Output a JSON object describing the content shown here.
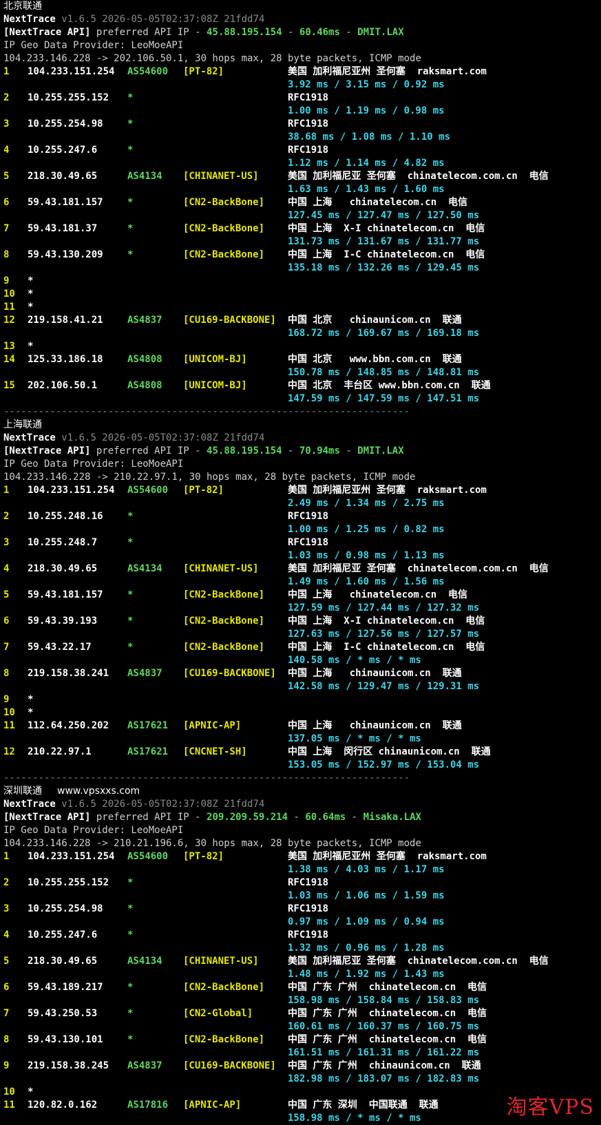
{
  "colors": {
    "background": "#000000",
    "hop": "#e6e600",
    "asn": "#5fd75f",
    "tag": "#e6e600",
    "latency": "#3fd3e6",
    "api": "#5fd75f",
    "version": "#8a8a8a"
  },
  "watermark": "淘客VPS",
  "sections": [
    {
      "title": "北京联通",
      "site": "",
      "brand": "NextTrace",
      "version": "v1.6.5 2026-05-05T02:37:08Z 21fdd74",
      "api_label": "[NextTrace API]",
      "api_text": "preferred API IP -",
      "api_ip": "45.88.195.154",
      "api_latency": "60.46ms",
      "api_node": "DMIT.LAX",
      "geo_provider": "IP Geo Data Provider: LeoMoeAPI",
      "trace_line": "104.233.146.228 -> 202.106.50.1, 30 hops max, 28 byte packets, ICMP mode",
      "separator": "----------------------------------------------------------------------",
      "hops": [
        {
          "hop": "1",
          "ip": "104.233.151.254",
          "asn": "AS54600",
          "tag": "[PT-82]",
          "geo": "美国 加利福尼亚州 圣何塞  raksmart.com",
          "latency": "3.92 ms / 3.15 ms / 0.92 ms"
        },
        {
          "hop": "2",
          "ip": "10.255.255.152",
          "asn": "*",
          "tag": "",
          "geo": "RFC1918",
          "latency": "1.00 ms / 1.19 ms / 0.98 ms"
        },
        {
          "hop": "3",
          "ip": "10.255.254.98",
          "asn": "*",
          "tag": "",
          "geo": "RFC1918",
          "latency": "38.68 ms / 1.08 ms / 1.10 ms"
        },
        {
          "hop": "4",
          "ip": "10.255.247.6",
          "asn": "*",
          "tag": "",
          "geo": "RFC1918",
          "latency": "1.12 ms / 1.14 ms / 4.82 ms"
        },
        {
          "hop": "5",
          "ip": "218.30.49.65",
          "asn": "AS4134",
          "tag": "[CHINANET-US]",
          "geo": "美国 加利福尼亚 圣何塞  chinatelecom.com.cn  电信",
          "latency": "1.63 ms / 1.43 ms / 1.60 ms"
        },
        {
          "hop": "6",
          "ip": "59.43.181.157",
          "asn": "*",
          "tag": "[CN2-BackBone]",
          "geo": "中国 上海   chinatelecom.cn  电信",
          "latency": "127.45 ms / 127.47 ms / 127.50 ms"
        },
        {
          "hop": "7",
          "ip": "59.43.181.37",
          "asn": "*",
          "tag": "[CN2-BackBone]",
          "geo": "中国 上海  X-I chinatelecom.cn  电信",
          "latency": "131.73 ms / 131.67 ms / 131.77 ms"
        },
        {
          "hop": "8",
          "ip": "59.43.130.209",
          "asn": "*",
          "tag": "[CN2-BackBone]",
          "geo": "中国 上海  I-C chinatelecom.cn  电信",
          "latency": "135.18 ms / 132.26 ms / 129.45 ms"
        },
        {
          "hop": "9",
          "ip": "*",
          "asn": "",
          "tag": "",
          "geo": "",
          "latency": ""
        },
        {
          "hop": "10",
          "ip": "*",
          "asn": "",
          "tag": "",
          "geo": "",
          "latency": ""
        },
        {
          "hop": "11",
          "ip": "*",
          "asn": "",
          "tag": "",
          "geo": "",
          "latency": ""
        },
        {
          "hop": "12",
          "ip": "219.158.41.21",
          "asn": "AS4837",
          "tag": "[CU169-BACKBONE]",
          "geo": "中国 北京   chinaunicom.cn  联通",
          "latency": "168.72 ms / 169.67 ms / 169.18 ms"
        },
        {
          "hop": "13",
          "ip": "*",
          "asn": "",
          "tag": "",
          "geo": "",
          "latency": ""
        },
        {
          "hop": "14",
          "ip": "125.33.186.18",
          "asn": "AS4808",
          "tag": "[UNICOM-BJ]",
          "geo": "中国 北京   www.bbn.com.cn  联通",
          "latency": "150.78 ms / 148.85 ms / 148.81 ms"
        },
        {
          "hop": "15",
          "ip": "202.106.50.1",
          "asn": "AS4808",
          "tag": "[UNICOM-BJ]",
          "geo": "中国 北京  丰台区 www.bbn.com.cn  联通",
          "latency": "147.59 ms / 147.59 ms / 147.51 ms"
        }
      ]
    },
    {
      "title": "上海联通",
      "site": "",
      "brand": "NextTrace",
      "version": "v1.6.5 2026-05-05T02:37:08Z 21fdd74",
      "api_label": "[NextTrace API]",
      "api_text": "preferred API IP -",
      "api_ip": "45.88.195.154",
      "api_latency": "70.94ms",
      "api_node": "DMIT.LAX",
      "geo_provider": "IP Geo Data Provider: LeoMoeAPI",
      "trace_line": "104.233.146.228 -> 210.22.97.1, 30 hops max, 28 byte packets, ICMP mode",
      "separator": "----------------------------------------------------------------------",
      "hops": [
        {
          "hop": "1",
          "ip": "104.233.151.254",
          "asn": "AS54600",
          "tag": "[PT-82]",
          "geo": "美国 加利福尼亚州 圣何塞  raksmart.com",
          "latency": "2.49 ms / 1.34 ms / 2.75 ms"
        },
        {
          "hop": "2",
          "ip": "10.255.248.16",
          "asn": "*",
          "tag": "",
          "geo": "RFC1918",
          "latency": "1.00 ms / 1.25 ms / 0.82 ms"
        },
        {
          "hop": "3",
          "ip": "10.255.248.7",
          "asn": "*",
          "tag": "",
          "geo": "RFC1918",
          "latency": "1.03 ms / 0.98 ms / 1.13 ms"
        },
        {
          "hop": "4",
          "ip": "218.30.49.65",
          "asn": "AS4134",
          "tag": "[CHINANET-US]",
          "geo": "美国 加利福尼亚 圣何塞  chinatelecom.com.cn  电信",
          "latency": "1.49 ms / 1.60 ms / 1.56 ms"
        },
        {
          "hop": "5",
          "ip": "59.43.181.157",
          "asn": "*",
          "tag": "[CN2-BackBone]",
          "geo": "中国 上海   chinatelecom.cn  电信",
          "latency": "127.59 ms / 127.44 ms / 127.32 ms"
        },
        {
          "hop": "6",
          "ip": "59.43.39.193",
          "asn": "*",
          "tag": "[CN2-BackBone]",
          "geo": "中国 上海  X-I chinatelecom.cn  电信",
          "latency": "127.63 ms / 127.56 ms / 127.57 ms"
        },
        {
          "hop": "7",
          "ip": "59.43.22.17",
          "asn": "*",
          "tag": "[CN2-BackBone]",
          "geo": "中国 上海  I-C chinatelecom.cn  电信",
          "latency": "140.58 ms / * ms / * ms"
        },
        {
          "hop": "8",
          "ip": "219.158.38.241",
          "asn": "AS4837",
          "tag": "[CU169-BACKBONE]",
          "geo": "中国 上海   chinaunicom.cn  联通",
          "latency": "142.58 ms / 129.47 ms / 129.31 ms"
        },
        {
          "hop": "9",
          "ip": "*",
          "asn": "",
          "tag": "",
          "geo": "",
          "latency": ""
        },
        {
          "hop": "10",
          "ip": "*",
          "asn": "",
          "tag": "",
          "geo": "",
          "latency": ""
        },
        {
          "hop": "11",
          "ip": "112.64.250.202",
          "asn": "AS17621",
          "tag": "[APNIC-AP]",
          "geo": "中国 上海   chinaunicom.cn  联通",
          "latency": "137.05 ms / * ms / * ms"
        },
        {
          "hop": "12",
          "ip": "210.22.97.1",
          "asn": "AS17621",
          "tag": "[CNCNET-SH]",
          "geo": "中国 上海  闵行区 chinaunicom.cn  联通",
          "latency": "153.05 ms / 152.97 ms / 153.04 ms"
        }
      ]
    },
    {
      "title": "深圳联通",
      "site": "www.vpsxxs.com",
      "brand": "NextTrace",
      "version": "v1.6.5 2026-05-05T02:37:08Z 21fdd74",
      "api_label": "[NextTrace API]",
      "api_text": "preferred API IP -",
      "api_ip": "209.209.59.214",
      "api_latency": "60.64ms",
      "api_node": "Misaka.LAX",
      "geo_provider": "IP Geo Data Provider: LeoMoeAPI",
      "trace_line": "104.233.146.228 -> 210.21.196.6, 30 hops max, 28 byte packets, ICMP mode",
      "separator": "",
      "hops": [
        {
          "hop": "1",
          "ip": "104.233.151.254",
          "asn": "AS54600",
          "tag": "[PT-82]",
          "geo": "美国 加利福尼亚州 圣何塞  raksmart.com",
          "latency": "1.38 ms / 4.03 ms / 1.17 ms"
        },
        {
          "hop": "2",
          "ip": "10.255.255.152",
          "asn": "*",
          "tag": "",
          "geo": "RFC1918",
          "latency": "1.03 ms / 1.06 ms / 1.59 ms"
        },
        {
          "hop": "3",
          "ip": "10.255.254.98",
          "asn": "*",
          "tag": "",
          "geo": "RFC1918",
          "latency": "0.97 ms / 1.09 ms / 0.94 ms"
        },
        {
          "hop": "4",
          "ip": "10.255.247.6",
          "asn": "*",
          "tag": "",
          "geo": "RFC1918",
          "latency": "1.32 ms / 0.96 ms / 1.28 ms"
        },
        {
          "hop": "5",
          "ip": "218.30.49.65",
          "asn": "AS4134",
          "tag": "[CHINANET-US]",
          "geo": "美国 加利福尼亚 圣何塞  chinatelecom.com.cn  电信",
          "latency": "1.48 ms / 1.92 ms / 1.43 ms"
        },
        {
          "hop": "6",
          "ip": "59.43.189.217",
          "asn": "*",
          "tag": "[CN2-BackBone]",
          "geo": "中国 广东 广州  chinatelecom.cn  电信",
          "latency": "158.98 ms / 158.84 ms / 158.83 ms"
        },
        {
          "hop": "7",
          "ip": "59.43.250.53",
          "asn": "*",
          "tag": "[CN2-Global]",
          "geo": "中国 广东 广州  chinatelecom.cn  电信",
          "latency": "160.61 ms / 160.37 ms / 160.75 ms"
        },
        {
          "hop": "8",
          "ip": "59.43.130.101",
          "asn": "*",
          "tag": "[CN2-BackBone]",
          "geo": "中国 广东 广州  chinatelecom.cn  电信",
          "latency": "161.51 ms / 161.31 ms / 161.22 ms"
        },
        {
          "hop": "9",
          "ip": "219.158.38.245",
          "asn": "AS4837",
          "tag": "[CU169-BACKBONE]",
          "geo": "中国 广东 广州  chinaunicom.cn  联通",
          "latency": "182.98 ms / 183.07 ms / 182.83 ms"
        },
        {
          "hop": "10",
          "ip": "*",
          "asn": "",
          "tag": "",
          "geo": "",
          "latency": ""
        },
        {
          "hop": "11",
          "ip": "120.82.0.162",
          "asn": "AS17816",
          "tag": "[APNIC-AP]",
          "geo": "中国 广东 深圳  中国联通  联通",
          "latency": "158.98 ms / * ms / * ms"
        }
      ]
    }
  ]
}
